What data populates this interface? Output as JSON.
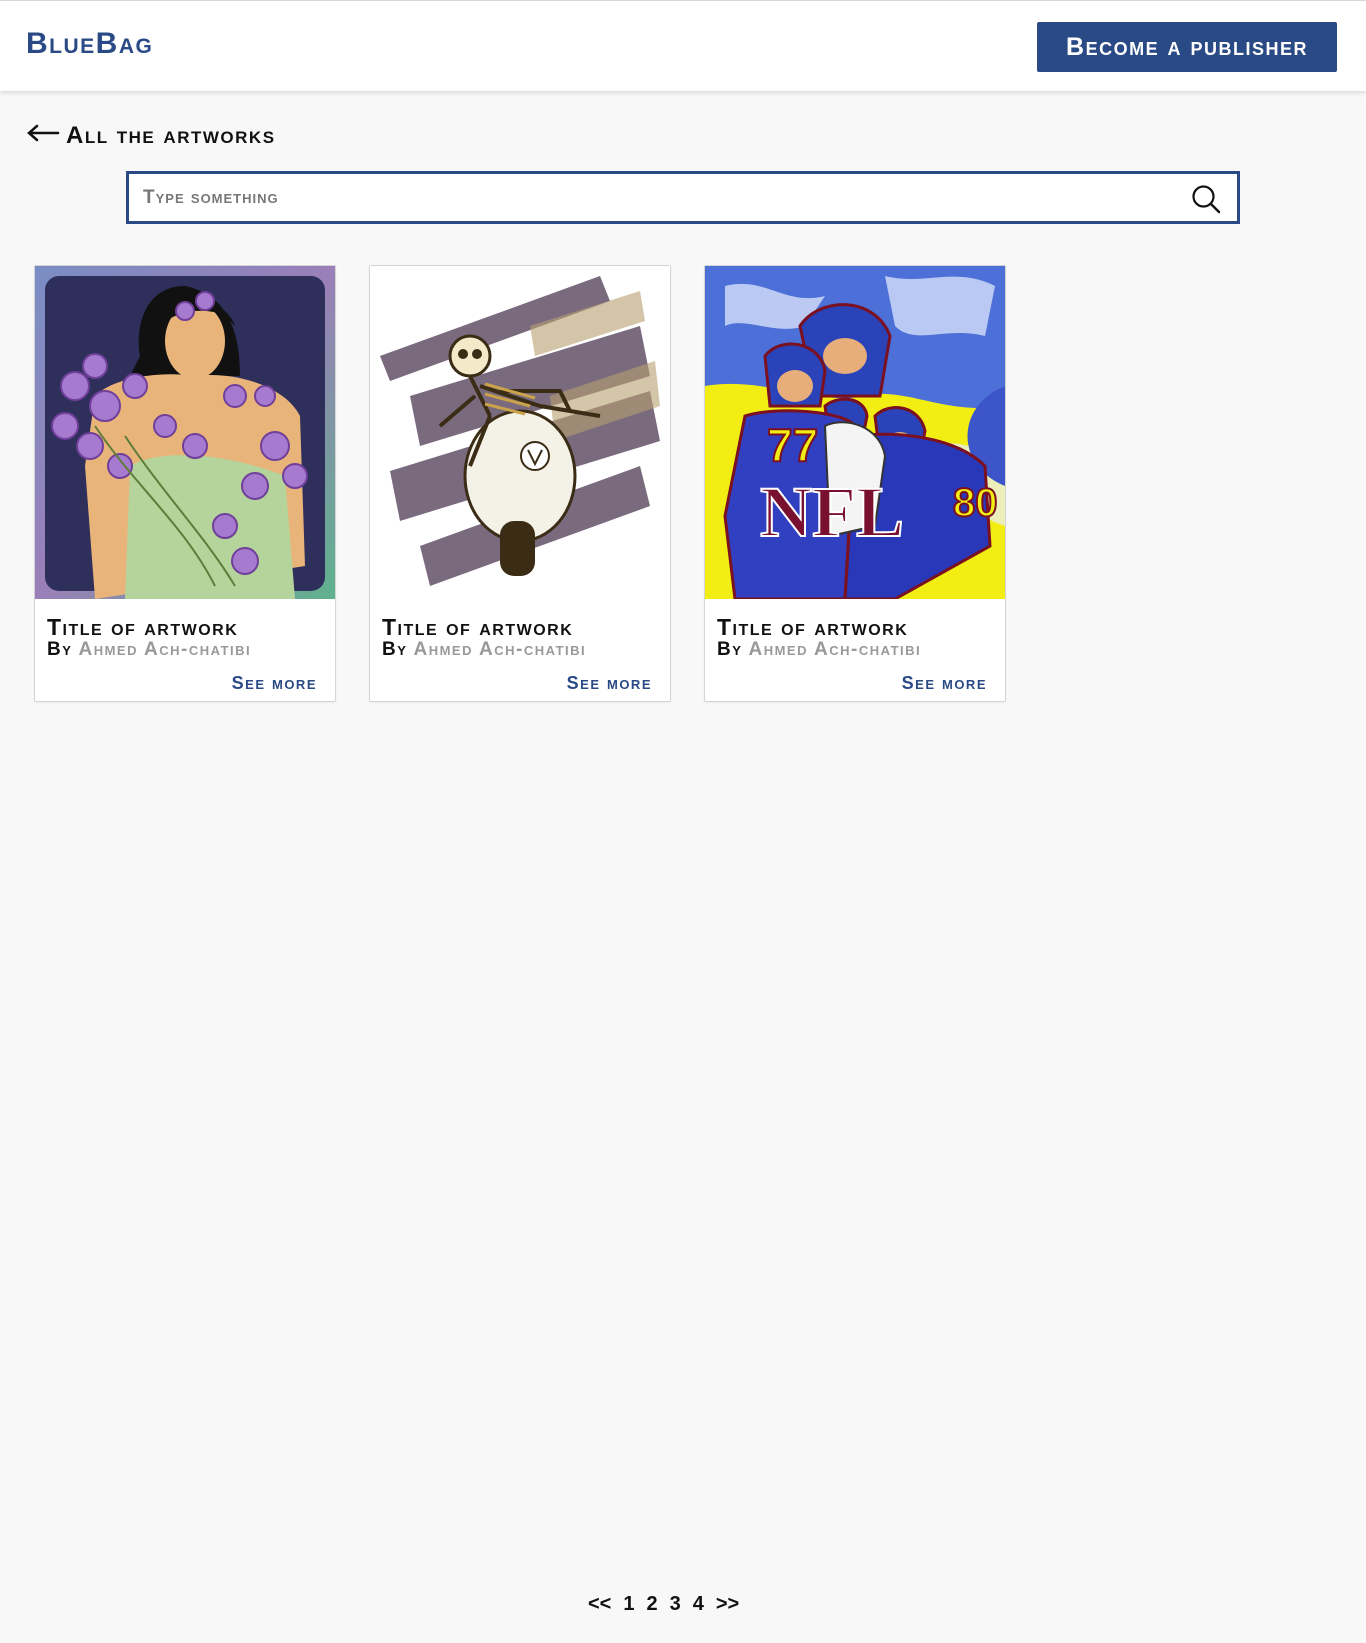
{
  "header": {
    "brand": "BlueBag",
    "publish_label": "Become a publisher",
    "accent": "#2a4a86"
  },
  "back": {
    "icon": "arrow-left-icon",
    "label": "All the artworks"
  },
  "search": {
    "placeholder": "Type something",
    "value": "",
    "icon": "search-icon"
  },
  "cards": [
    {
      "image": "woman-with-flowers-illustration",
      "title": "Title of artwork",
      "by": "By",
      "author": "Ahmed Ach-chatibi",
      "more": "See more"
    },
    {
      "image": "skeleton-on-scooter-illustration",
      "title": "Title of artwork",
      "by": "By",
      "author": "Ahmed Ach-chatibi",
      "more": "See more"
    },
    {
      "image": "nfl-players-pop-art",
      "title": "Title of artwork",
      "by": "By",
      "author": "Ahmed Ach-chatibi",
      "more": "See more",
      "image_text": "NFL"
    }
  ],
  "pagination": {
    "prev": "<<",
    "pages": [
      "1",
      "2",
      "3",
      "4"
    ],
    "next": ">>"
  }
}
